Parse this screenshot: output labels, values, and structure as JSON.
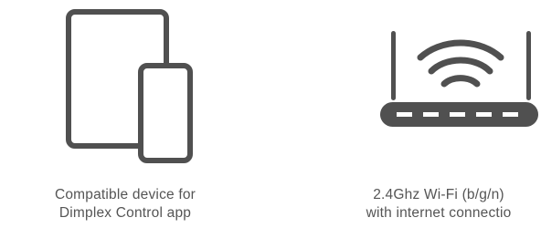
{
  "requirements": [
    {
      "icon": "tablet-and-phone-icon",
      "caption_line1": "Compatible device for",
      "caption_line2": "Dimplex Control app"
    },
    {
      "icon": "wifi-router-icon",
      "caption_line1": "2.4Ghz Wi-Fi (b/g/n)",
      "caption_line2": "with internet connectio"
    }
  ],
  "colors": {
    "icon": "#505050",
    "text": "#555555",
    "background": "#ffffff"
  }
}
